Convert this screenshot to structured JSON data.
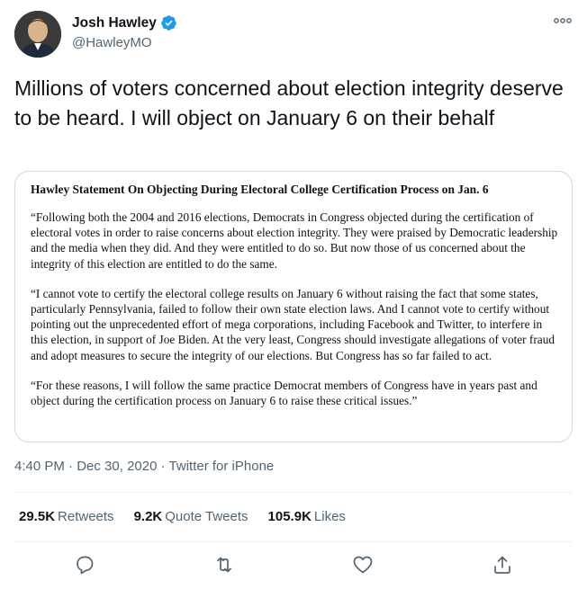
{
  "author": {
    "name": "Josh Hawley",
    "handle": "@HawleyMO"
  },
  "tweet": {
    "text": "Millions of voters concerned about election integrity deserve to be heard. I will object on January 6 on their behalf"
  },
  "attached_image": {
    "title": "Hawley Statement On Objecting During Electoral College Certification Process on Jan. 6",
    "paragraphs": [
      "“Following both the 2004 and 2016 elections, Democrats in Congress objected during the certification of electoral votes in order to raise concerns about election integrity. They were praised by Democratic leadership and the media when they did. And they were entitled to do so. But now those of us concerned about the integrity of this election are entitled to do the same.",
      "“I cannot vote to certify the electoral college results on January 6 without raising the fact that some states, particularly Pennsylvania, failed to follow their own state election laws. And I cannot vote to certify without pointing out the unprecedented effort of mega corporations, including Facebook and Twitter, to interfere in this election, in support of Joe Biden. At the very least, Congress should investigate allegations of voter fraud and adopt measures to secure the integrity of our elections. But Congress has so far failed to act.",
      "“For these reasons, I will follow the same practice Democrat members of Congress have in years past and object during the certification process on January 6 to raise these critical issues.”"
    ]
  },
  "meta": {
    "time": "4:40 PM",
    "separator": "·",
    "date": "Dec 30, 2020",
    "source": "Twitter for iPhone"
  },
  "stats": {
    "retweets_count": "29.5K",
    "retweets_label": "Retweets",
    "quotes_count": "9.2K",
    "quotes_label": "Quote Tweets",
    "likes_count": "105.9K",
    "likes_label": "Likes"
  },
  "colors": {
    "verified": "#1d9bf0",
    "icon": "#536471",
    "divider": "#eff3f4"
  },
  "icons": [
    "verified-badge-icon",
    "more-options-icon",
    "reply-icon",
    "retweet-icon",
    "like-icon",
    "share-icon"
  ]
}
